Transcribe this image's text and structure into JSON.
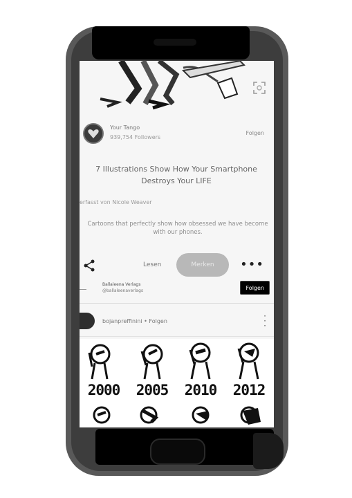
{
  "article": {
    "author_name": "Your Tango",
    "author_followers": "939,754 Followers",
    "follow_label": "Folgen",
    "title": "7 Illustrations Show How Your Smartphone Destroys Your LIFE",
    "created_by": "erfasst von Nicole Weaver",
    "description": "Cartoons that perfectly show how obsessed we have become with our phones."
  },
  "actions": {
    "save_label": "Lesen",
    "visit_label": "Merken",
    "more_label": "•••"
  },
  "board": {
    "name": "Ballaleena Verlags",
    "handle": "@ballaleenaverlags",
    "follow_label": "Folgen"
  },
  "pin": {
    "user_line": "bojanpreffinini • Folgen"
  },
  "comic": {
    "years": [
      "2000",
      "2005",
      "2010",
      "2012"
    ]
  },
  "colors": {
    "frame": "#595959",
    "screen": "#f6f6f6",
    "visit_button": "#b8b8b8"
  }
}
